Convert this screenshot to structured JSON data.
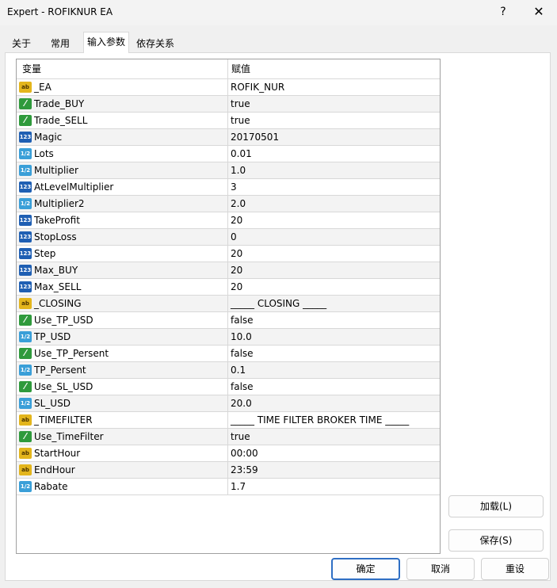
{
  "window": {
    "title": "Expert - ROFIKNUR EA",
    "help": "?",
    "close": "✕"
  },
  "tabs": [
    "关于",
    "常用",
    "输入参数",
    "依存关系"
  ],
  "grid": {
    "col_variable": "变量",
    "col_value": "赋值",
    "rows": [
      {
        "type": "string",
        "icon": "ab",
        "name": "_EA",
        "value": "ROFIK_NUR"
      },
      {
        "type": "bool",
        "icon": "bool",
        "name": "Trade_BUY",
        "value": "true"
      },
      {
        "type": "bool",
        "icon": "bool",
        "name": "Trade_SELL",
        "value": "true"
      },
      {
        "type": "int",
        "icon": "123",
        "name": "Magic",
        "value": "20170501"
      },
      {
        "type": "double",
        "icon": "1/2",
        "name": "Lots",
        "value": "0.01"
      },
      {
        "type": "double",
        "icon": "1/2",
        "name": "Multiplier",
        "value": "1.0"
      },
      {
        "type": "int",
        "icon": "123",
        "name": "AtLevelMultiplier",
        "value": "3"
      },
      {
        "type": "double",
        "icon": "1/2",
        "name": "Multiplier2",
        "value": "2.0"
      },
      {
        "type": "int",
        "icon": "123",
        "name": "TakeProfit",
        "value": "20"
      },
      {
        "type": "int",
        "icon": "123",
        "name": "StopLoss",
        "value": "0"
      },
      {
        "type": "int",
        "icon": "123",
        "name": "Step",
        "value": "20"
      },
      {
        "type": "int",
        "icon": "123",
        "name": "Max_BUY",
        "value": "20"
      },
      {
        "type": "int",
        "icon": "123",
        "name": "Max_SELL",
        "value": "20"
      },
      {
        "type": "string",
        "icon": "ab",
        "name": "_CLOSING",
        "value": "_____ CLOSING _____"
      },
      {
        "type": "bool",
        "icon": "bool",
        "name": "Use_TP_USD",
        "value": "false"
      },
      {
        "type": "double",
        "icon": "1/2",
        "name": "TP_USD",
        "value": "10.0"
      },
      {
        "type": "bool",
        "icon": "bool",
        "name": "Use_TP_Persent",
        "value": "false"
      },
      {
        "type": "double",
        "icon": "1/2",
        "name": "TP_Persent",
        "value": "0.1"
      },
      {
        "type": "bool",
        "icon": "bool",
        "name": "Use_SL_USD",
        "value": "false"
      },
      {
        "type": "double",
        "icon": "1/2",
        "name": "SL_USD",
        "value": "20.0"
      },
      {
        "type": "string",
        "icon": "ab",
        "name": "_TIMEFILTER",
        "value": "_____ TIME FILTER BROKER TIME _____"
      },
      {
        "type": "bool",
        "icon": "bool",
        "name": "Use_TimeFilter",
        "value": "true"
      },
      {
        "type": "string",
        "icon": "ab",
        "name": "StartHour",
        "value": "00:00"
      },
      {
        "type": "string",
        "icon": "ab",
        "name": "EndHour",
        "value": "23:59"
      },
      {
        "type": "double",
        "icon": "1/2",
        "name": "Rabate",
        "value": "1.7"
      }
    ]
  },
  "side_buttons": {
    "load": "加载(L)",
    "save": "保存(S)"
  },
  "footer": {
    "ok": "确定",
    "cancel": "取消",
    "reset": "重设"
  }
}
